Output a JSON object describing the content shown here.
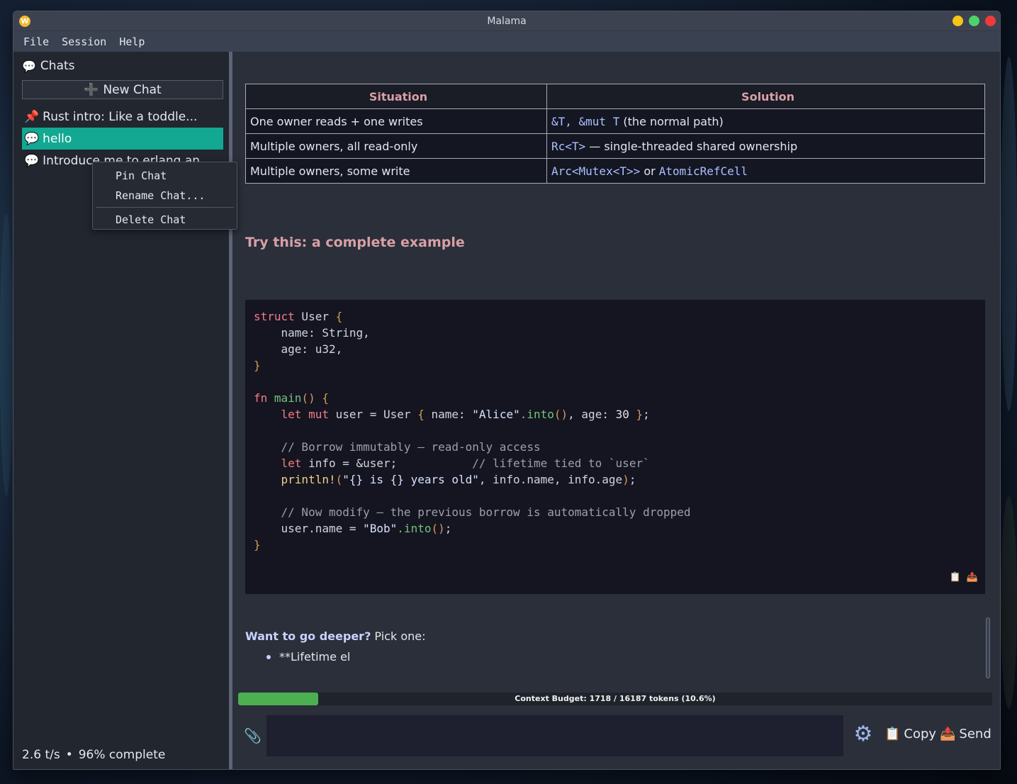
{
  "window": {
    "title": "Malama",
    "logo": "W"
  },
  "menu": [
    "File",
    "Session",
    "Help"
  ],
  "sidebar": {
    "header": "Chats",
    "new_chat_label": "New Chat",
    "chats": [
      {
        "icon": "📌",
        "label": "Rust intro: Like a toddle...",
        "selected": false
      },
      {
        "icon": "💬",
        "label": "hello",
        "selected": true
      },
      {
        "icon": "💬",
        "label": "Introduce me to erlang an",
        "selected": false
      }
    ],
    "status": {
      "speed": "2.6 t/s",
      "separator": "•",
      "progress": "96% complete"
    }
  },
  "context_menu": {
    "items": [
      "Pin Chat",
      "Rename Chat...",
      "Delete Chat"
    ]
  },
  "table": {
    "headers": [
      "Situation",
      "Solution"
    ],
    "rows": [
      {
        "situation": "One owner reads + one writes",
        "solution_code": "&T, &mut  T",
        "solution_text": " (the normal path)"
      },
      {
        "situation": "Multiple owners, all read-only",
        "solution_code": "Rc<T>",
        "solution_text": " — single-threaded shared ownership"
      },
      {
        "situation": "Multiple owners, some write",
        "solution_code": "Arc<Mutex<T>>",
        "solution_text": " or ",
        "solution_code2": "AtomicRefCell"
      }
    ]
  },
  "section_heading": "Try this: a complete example",
  "code": {
    "line1_kw": "struct",
    "line1_rest": " User ",
    "brace_open": "{",
    "line2": "    name: String,",
    "line3": "    age: u32,",
    "brace_close": "}",
    "fn_kw": "fn",
    "fn_name": "main",
    "fn_paren": "()",
    "let_mut": "    let mut",
    "user_decl": " user = User ",
    "name_field": " name: ",
    "alice": "\"Alice\"",
    "into": ".into",
    "age_field": ", age: ",
    "age_val": "30",
    "end_semicolon": ";",
    "comment1": "    // Borrow immutably — read-only access",
    "let_kw": "    let",
    "info_decl": " info = &user;",
    "comment2": "           // lifetime tied to `user`",
    "println": "    println!",
    "fmt_str": "\"{} is {} years old\"",
    "println_args": ", info.name, info.age",
    "comment3": "    // Now modify — the previous borrow is automatically dropped",
    "assign": "    user.name = ",
    "bob": "\"Bob\"",
    "icons": [
      "clipboard-icon",
      "outbox-icon"
    ]
  },
  "deeper": {
    "bold": "Want to go deeper?",
    "rest": " Pick one:",
    "bullet": "**Lifetime el"
  },
  "budget": {
    "label": "Context Budget: 1718 / 16187 tokens (10.6%)",
    "fraction": 0.106
  },
  "actions": {
    "copy": "Copy",
    "send": "Send"
  },
  "colors": {
    "accent": "#12a892",
    "budget": "#4caf50",
    "heading": "#d8a0a6"
  }
}
